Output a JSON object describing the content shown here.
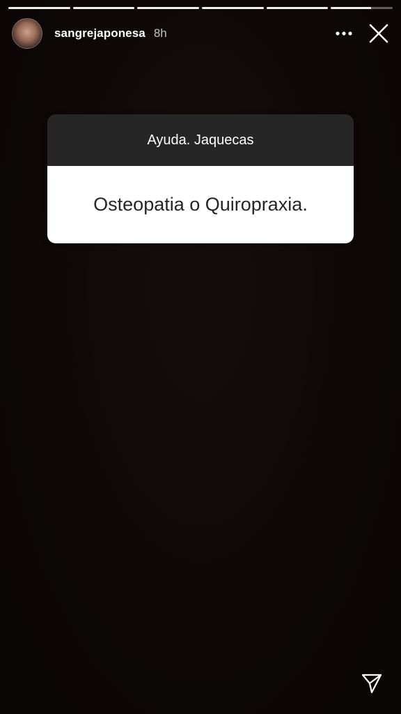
{
  "progress": {
    "segments": [
      1,
      1,
      1,
      1,
      1,
      0.65
    ]
  },
  "header": {
    "username": "sangrejaponesa",
    "time": "8h",
    "more_icon": "more-horizontal-icon",
    "close_icon": "close-icon"
  },
  "question_box": {
    "question": "Ayuda. Jaquecas",
    "answer": "Osteopatia o Quiropraxia."
  },
  "footer": {
    "share_icon": "paper-plane-icon"
  },
  "colors": {
    "background": "#0e0908",
    "box_header": "#262626",
    "box_body": "#ffffff",
    "text_dark": "#262626"
  }
}
